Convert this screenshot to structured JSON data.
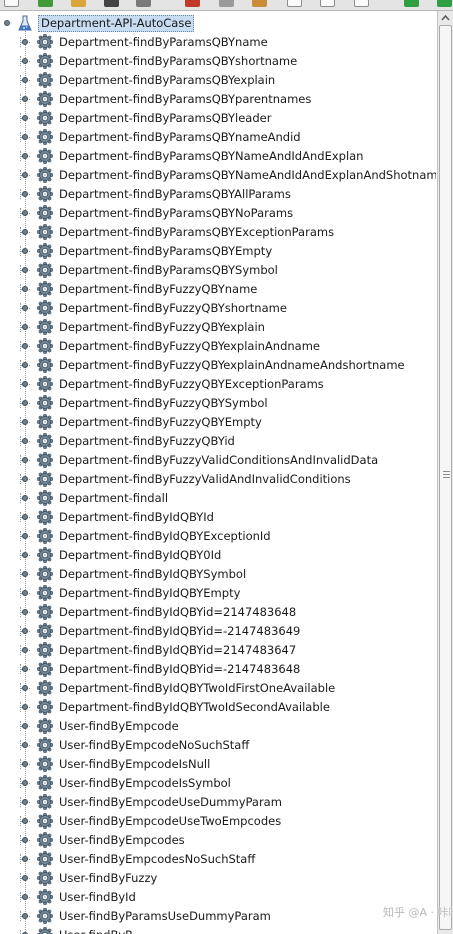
{
  "toolbar": {
    "buttons": [
      {
        "icon": "new-icon",
        "color": "#fbfbfb"
      },
      {
        "icon": "add-icon",
        "color": "#3f9a3a"
      },
      {
        "icon": "folder-icon",
        "color": "#d8a63a"
      },
      {
        "icon": "recorder-icon",
        "color": "#444444"
      },
      {
        "icon": "image-icon",
        "color": "#7a7a7a"
      },
      {
        "icon": "cut-icon",
        "color": "#c0392b"
      },
      {
        "icon": "copy-icon",
        "color": "#9a9a9a"
      },
      {
        "icon": "paste-icon",
        "color": "#c98d3a"
      },
      {
        "icon": "expand-icon",
        "color": "#fbfbfb"
      },
      {
        "icon": "collapse-icon",
        "color": "#fbfbfb"
      },
      {
        "icon": "toggle-icon",
        "color": "#fbfbfb"
      },
      {
        "icon": "start-icon",
        "color": "#2ea043"
      },
      {
        "icon": "start-no-pause-icon",
        "color": "#2ea043"
      }
    ]
  },
  "tree": {
    "root": {
      "label": "Department-API-AutoCase",
      "icon": "test-plan-icon"
    },
    "items": [
      {
        "label": "Department-findByParamsQBYname"
      },
      {
        "label": "Department-findByParamsQBYshortname"
      },
      {
        "label": "Department-findByParamsQBYexplain"
      },
      {
        "label": "Department-findByParamsQBYparentnames"
      },
      {
        "label": "Department-findByParamsQBYleader"
      },
      {
        "label": "Department-findByParamsQBYnameAndid"
      },
      {
        "label": "Department-findByParamsQBYNameAndIdAndExplan"
      },
      {
        "label": "Department-findByParamsQBYNameAndIdAndExplanAndShotname"
      },
      {
        "label": "Department-findByParamsQBYAllParams"
      },
      {
        "label": "Department-findByParamsQBYNoParams"
      },
      {
        "label": "Department-findByParamsQBYExceptionParams"
      },
      {
        "label": "Department-findByParamsQBYEmpty"
      },
      {
        "label": "Department-findByParamsQBYSymbol"
      },
      {
        "label": "Department-findByFuzzyQBYname"
      },
      {
        "label": "Department-findByFuzzyQBYshortname"
      },
      {
        "label": "Department-findByFuzzyQBYexplain"
      },
      {
        "label": "Department-findByFuzzyQBYexplainAndname"
      },
      {
        "label": "Department-findByFuzzyQBYexplainAndnameAndshortname"
      },
      {
        "label": "Department-findByFuzzyQBYExceptionParams"
      },
      {
        "label": "Department-findByFuzzyQBYSymbol"
      },
      {
        "label": "Department-findByFuzzyQBYEmpty"
      },
      {
        "label": "Department-findByFuzzyQBYid"
      },
      {
        "label": "Department-findByFuzzyValidConditionsAndInvalidData"
      },
      {
        "label": "Department-findByFuzzyValidAndInvalidConditions"
      },
      {
        "label": "Department-findall"
      },
      {
        "label": "Department-findByIdQBYId"
      },
      {
        "label": "Department-findByIdQBYExceptionId"
      },
      {
        "label": "Department-findByIdQBY0Id"
      },
      {
        "label": "Department-findByIdQBYSymbol"
      },
      {
        "label": "Department-findByIdQBYEmpty"
      },
      {
        "label": "Department-findByIdQBYid=2147483648"
      },
      {
        "label": "Department-findByIdQBYid=-2147483649"
      },
      {
        "label": "Department-findByIdQBYid=2147483647"
      },
      {
        "label": "Department-findByIdQBYid=-2147483648"
      },
      {
        "label": "Department-findByIdQBYTwoIdFirstOneAvailable"
      },
      {
        "label": "Department-findByIdQBYTwoIdSecondAvailable"
      },
      {
        "label": "User-findByEmpcode"
      },
      {
        "label": "User-findByEmpcodeNoSuchStaff"
      },
      {
        "label": "User-findByEmpcodeIsNull"
      },
      {
        "label": "User-findByEmpcodeIsSymbol"
      },
      {
        "label": "User-findByEmpcodeUseDummyParam"
      },
      {
        "label": "User-findByEmpcodeUseTwoEmpcodes"
      },
      {
        "label": "User-findByEmpcodes"
      },
      {
        "label": "User-findByEmpcodesNoSuchStaff"
      },
      {
        "label": "User-findByFuzzy"
      },
      {
        "label": "User-findById"
      },
      {
        "label": "User-findByParamsUseDummyParam"
      },
      {
        "label": "User-findByP..."
      }
    ],
    "item_icon": "thread-group-gear-icon"
  },
  "colors": {
    "selection_bg": "#c8dcf2",
    "gear": "#6f8494",
    "gear_dark": "#3d4c58"
  },
  "watermark": {
    "text": "知乎 @A · 咔咔"
  }
}
